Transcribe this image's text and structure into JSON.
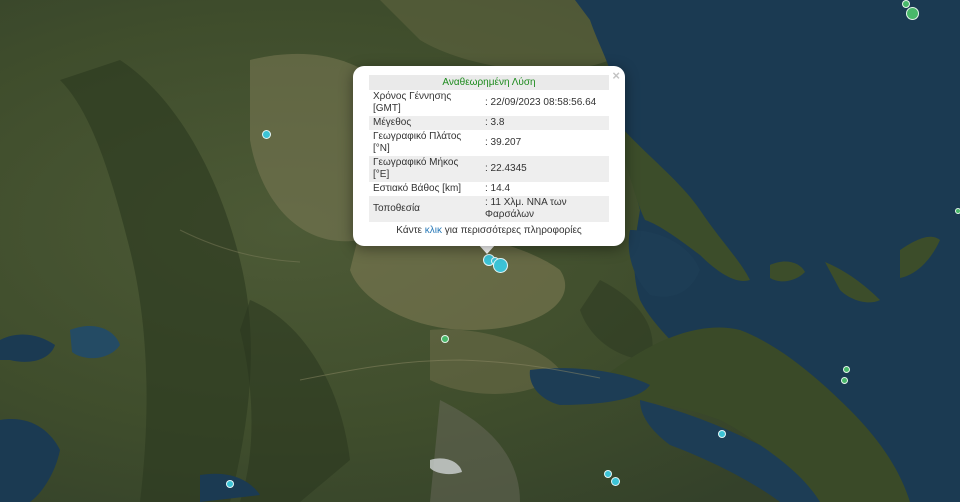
{
  "popup": {
    "title": "Αναθεωρημένη Λύση",
    "close_glyph": "×",
    "rows": [
      {
        "label": "Χρόνος Γέννησης [GMT]",
        "value": ": 22/09/2023 08:58:56.64"
      },
      {
        "label": "Μέγεθος",
        "value": ": 3.8"
      },
      {
        "label": "Γεωγραφικό Πλάτος [°N]",
        "value": ": 39.207"
      },
      {
        "label": "Γεωγραφικό Μήκος [°E]",
        "value": ": 22.4345"
      },
      {
        "label": "Εστιακό Βάθος [km]",
        "value": ": 14.4"
      },
      {
        "label": "Τοποθεσία",
        "value": ": 11 Χλμ. ΝΝΑ των Φαρσάλων"
      }
    ],
    "more_prefix": "Κάντε ",
    "more_link": "κλικ",
    "more_suffix": " για περισσότερες πληροφορίες"
  },
  "marker_color": "#3cc3d6",
  "marker_icon": "circle-marker"
}
